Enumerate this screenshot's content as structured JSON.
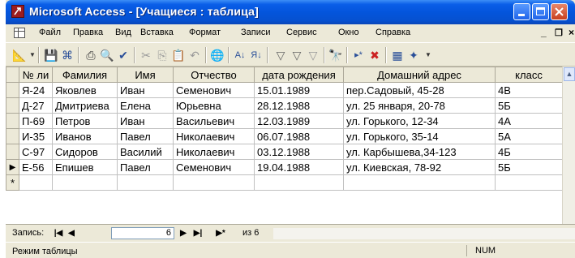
{
  "window": {
    "title": "Microsoft Access - [Учащиеся : таблица]"
  },
  "menu": [
    "Файл",
    "Правка",
    "Вид",
    "Вставка",
    "Формат",
    "Записи",
    "Сервис",
    "Окно",
    "Справка"
  ],
  "table": {
    "columns": [
      "№ ли",
      "Фамилия",
      "Имя",
      "Отчество",
      "дата рождения",
      "Домашний адрес",
      "класс"
    ],
    "rows": [
      [
        "Я-24",
        "Яковлев",
        "Иван",
        "Семенович",
        "15.01.1989",
        "пер.Садовый, 45-28",
        "4В"
      ],
      [
        "Д-27",
        "Дмитриева",
        "Елена",
        "Юрьевна",
        "28.12.1988",
        "ул. 25 января, 20-78",
        "5Б"
      ],
      [
        "П-69",
        "Петров",
        "Иван",
        "Васильевич",
        "12.03.1989",
        "ул. Горького, 12-34",
        "4А"
      ],
      [
        "И-35",
        "Иванов",
        "Павел",
        "Николаевич",
        "06.07.1988",
        "ул. Горького, 35-14",
        "5А"
      ],
      [
        "С-97",
        "Сидоров",
        "Василий",
        "Николаевич",
        "03.12.1988",
        "ул. Карбышева,34-123",
        "4Б"
      ],
      [
        "Е-56",
        "Епишев",
        "Павел",
        "Семенович",
        "19.04.1988",
        "ул. Киевская, 78-92",
        "5Б"
      ]
    ],
    "current_row_marker": "▶",
    "new_row_marker": "*"
  },
  "navigator": {
    "label": "Запись:",
    "current": "6",
    "of_text": "из 6"
  },
  "status": {
    "mode": "Режим таблицы",
    "num": "NUM"
  },
  "icons": {
    "first": "first-record-icon",
    "prev": "previous-record-icon",
    "next": "next-record-icon",
    "last": "last-record-icon",
    "new": "new-record-icon"
  }
}
